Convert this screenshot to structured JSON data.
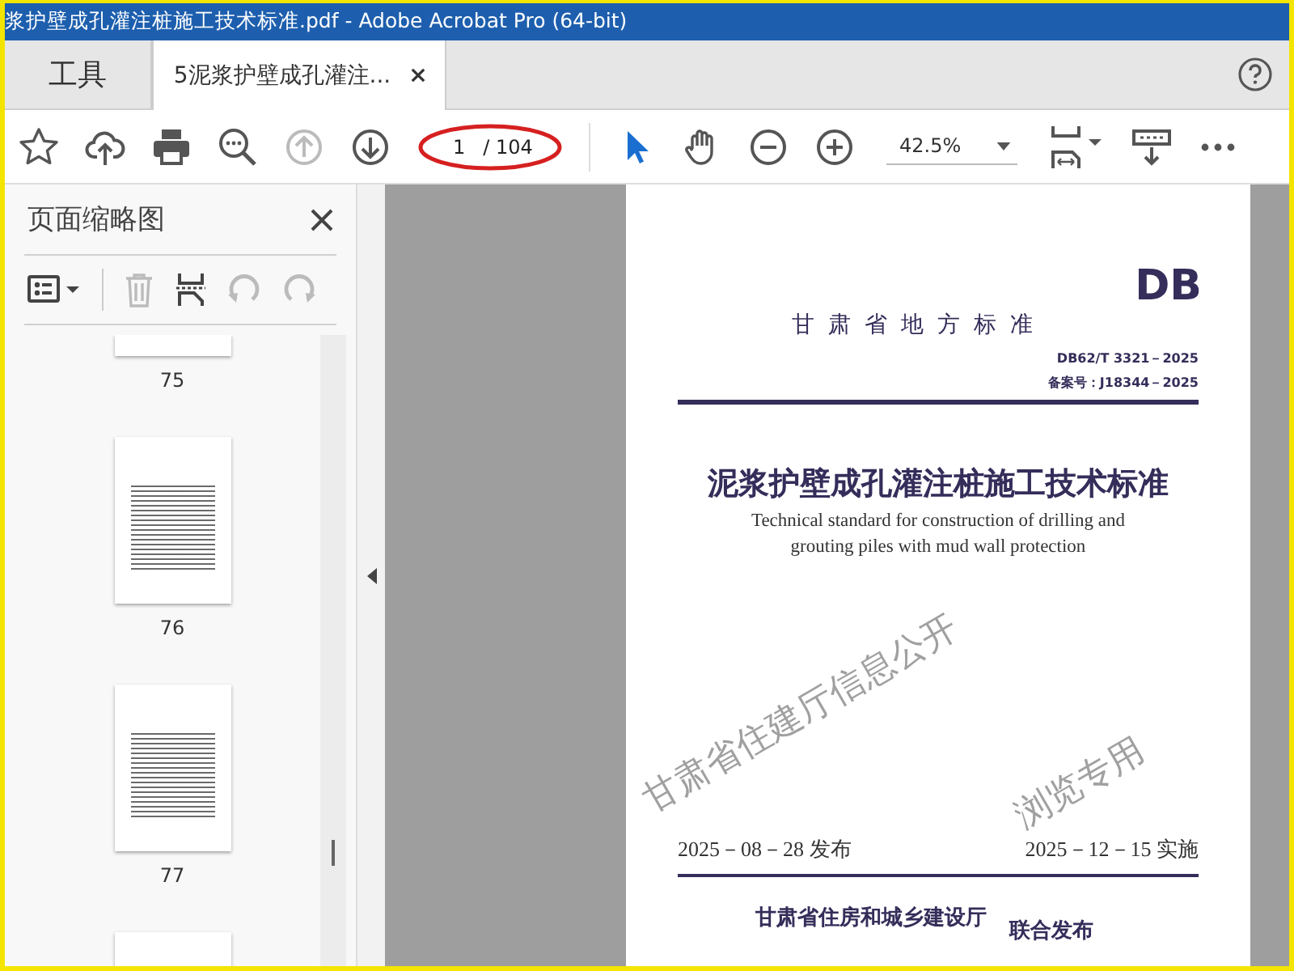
{
  "window": {
    "title": "浆护壁成孔灌注桩施工技术标准.pdf - Adobe Acrobat Pro (64-bit)"
  },
  "tabs": [
    {
      "label": "工具",
      "selected": false
    },
    {
      "label": "5泥浆护壁成孔灌注...",
      "selected": true
    }
  ],
  "toolbar": {
    "page_value": "1",
    "page_total": "/ 104",
    "zoom": "42.5%"
  },
  "sidebar": {
    "title": "页面缩略图",
    "thumbnails": [
      {
        "label": "75"
      },
      {
        "label": "76"
      },
      {
        "label": "77"
      }
    ]
  },
  "document": {
    "mark": "DB",
    "header": "甘 肃 省 地 方 标 准",
    "code": "DB62/T 3321－2025",
    "record": "备案号：J18344－2025",
    "title": "泥浆护壁成孔灌注桩施工技术标准",
    "title_en": [
      "Technical standard for construction of drilling and",
      "grouting piles with mud wall protection"
    ],
    "issue_date": "2025－08－28 发布",
    "effective_date": "2025－12－15 实施",
    "issuer": "甘肃省住房和城乡建设厅",
    "joint": "联合发布",
    "watermark": [
      "甘肃省住建厅信息公开",
      "浏览专用"
    ]
  }
}
